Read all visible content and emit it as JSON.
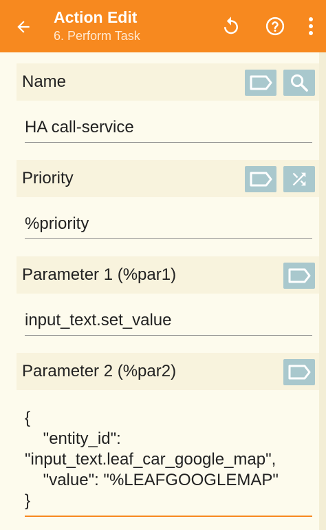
{
  "app_bar": {
    "title": "Action Edit",
    "subtitle": "6. Perform Task",
    "accent_color": "#f7891f",
    "icons": [
      "back-arrow-icon",
      "reset-icon",
      "help-icon",
      "more-vert-icon"
    ]
  },
  "sections": [
    {
      "label": "Name",
      "value": "HA call-service",
      "buttons": [
        "tag-icon",
        "search-icon"
      ]
    },
    {
      "label": "Priority",
      "value": "%priority",
      "buttons": [
        "tag-icon",
        "shuffle-icon"
      ]
    },
    {
      "label": "Parameter 1 (%par1)",
      "value": "input_text.set_value",
      "buttons": [
        "tag-icon"
      ]
    },
    {
      "label": "Parameter 2 (%par2)",
      "value": "{\n    \"entity_id\":\n\"input_text.leaf_car_google_map\",\n    \"value\": \"%LEAFGOOGLEMAP\"\n}",
      "buttons": [
        "tag-icon"
      ]
    }
  ],
  "button_color": "#a9c8cd"
}
